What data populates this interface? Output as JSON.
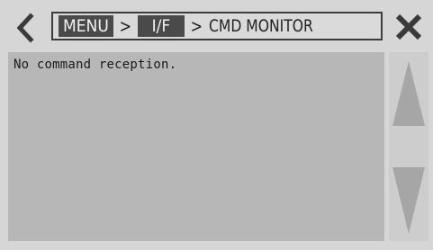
{
  "header": {
    "breadcrumb": {
      "items": [
        "MENU",
        "I/F"
      ],
      "separator": ">",
      "current": "CMD MONITOR"
    }
  },
  "icons": {
    "back": "chevron-left-icon",
    "close": "close-icon",
    "scroll_up": "triangle-up-icon",
    "scroll_down": "triangle-down-icon"
  },
  "monitor": {
    "message": "No command reception."
  },
  "colors": {
    "background": "#d6d6d6",
    "panel": "#b7b7b7",
    "crumb_box": "#4a4a4a",
    "scroll_arrows": "#a6a6a6"
  }
}
